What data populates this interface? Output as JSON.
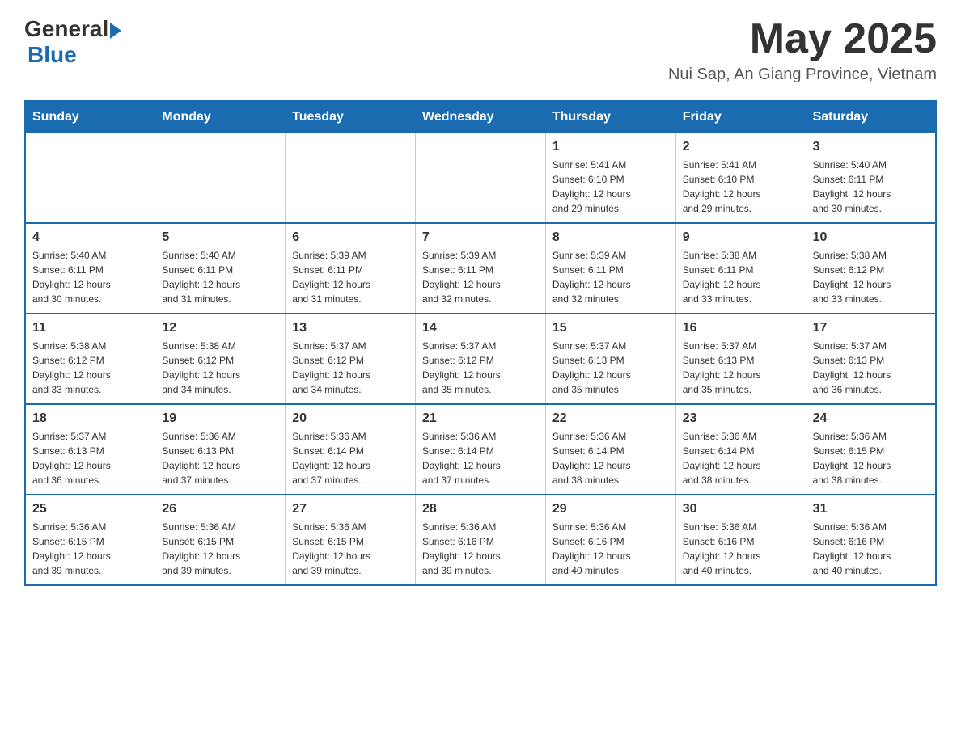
{
  "header": {
    "logo_general": "General",
    "logo_blue": "Blue",
    "month_title": "May 2025",
    "location": "Nui Sap, An Giang Province, Vietnam"
  },
  "weekdays": [
    "Sunday",
    "Monday",
    "Tuesday",
    "Wednesday",
    "Thursday",
    "Friday",
    "Saturday"
  ],
  "weeks": [
    [
      {
        "day": "",
        "info": ""
      },
      {
        "day": "",
        "info": ""
      },
      {
        "day": "",
        "info": ""
      },
      {
        "day": "",
        "info": ""
      },
      {
        "day": "1",
        "info": "Sunrise: 5:41 AM\nSunset: 6:10 PM\nDaylight: 12 hours\nand 29 minutes."
      },
      {
        "day": "2",
        "info": "Sunrise: 5:41 AM\nSunset: 6:10 PM\nDaylight: 12 hours\nand 29 minutes."
      },
      {
        "day": "3",
        "info": "Sunrise: 5:40 AM\nSunset: 6:11 PM\nDaylight: 12 hours\nand 30 minutes."
      }
    ],
    [
      {
        "day": "4",
        "info": "Sunrise: 5:40 AM\nSunset: 6:11 PM\nDaylight: 12 hours\nand 30 minutes."
      },
      {
        "day": "5",
        "info": "Sunrise: 5:40 AM\nSunset: 6:11 PM\nDaylight: 12 hours\nand 31 minutes."
      },
      {
        "day": "6",
        "info": "Sunrise: 5:39 AM\nSunset: 6:11 PM\nDaylight: 12 hours\nand 31 minutes."
      },
      {
        "day": "7",
        "info": "Sunrise: 5:39 AM\nSunset: 6:11 PM\nDaylight: 12 hours\nand 32 minutes."
      },
      {
        "day": "8",
        "info": "Sunrise: 5:39 AM\nSunset: 6:11 PM\nDaylight: 12 hours\nand 32 minutes."
      },
      {
        "day": "9",
        "info": "Sunrise: 5:38 AM\nSunset: 6:11 PM\nDaylight: 12 hours\nand 33 minutes."
      },
      {
        "day": "10",
        "info": "Sunrise: 5:38 AM\nSunset: 6:12 PM\nDaylight: 12 hours\nand 33 minutes."
      }
    ],
    [
      {
        "day": "11",
        "info": "Sunrise: 5:38 AM\nSunset: 6:12 PM\nDaylight: 12 hours\nand 33 minutes."
      },
      {
        "day": "12",
        "info": "Sunrise: 5:38 AM\nSunset: 6:12 PM\nDaylight: 12 hours\nand 34 minutes."
      },
      {
        "day": "13",
        "info": "Sunrise: 5:37 AM\nSunset: 6:12 PM\nDaylight: 12 hours\nand 34 minutes."
      },
      {
        "day": "14",
        "info": "Sunrise: 5:37 AM\nSunset: 6:12 PM\nDaylight: 12 hours\nand 35 minutes."
      },
      {
        "day": "15",
        "info": "Sunrise: 5:37 AM\nSunset: 6:13 PM\nDaylight: 12 hours\nand 35 minutes."
      },
      {
        "day": "16",
        "info": "Sunrise: 5:37 AM\nSunset: 6:13 PM\nDaylight: 12 hours\nand 35 minutes."
      },
      {
        "day": "17",
        "info": "Sunrise: 5:37 AM\nSunset: 6:13 PM\nDaylight: 12 hours\nand 36 minutes."
      }
    ],
    [
      {
        "day": "18",
        "info": "Sunrise: 5:37 AM\nSunset: 6:13 PM\nDaylight: 12 hours\nand 36 minutes."
      },
      {
        "day": "19",
        "info": "Sunrise: 5:36 AM\nSunset: 6:13 PM\nDaylight: 12 hours\nand 37 minutes."
      },
      {
        "day": "20",
        "info": "Sunrise: 5:36 AM\nSunset: 6:14 PM\nDaylight: 12 hours\nand 37 minutes."
      },
      {
        "day": "21",
        "info": "Sunrise: 5:36 AM\nSunset: 6:14 PM\nDaylight: 12 hours\nand 37 minutes."
      },
      {
        "day": "22",
        "info": "Sunrise: 5:36 AM\nSunset: 6:14 PM\nDaylight: 12 hours\nand 38 minutes."
      },
      {
        "day": "23",
        "info": "Sunrise: 5:36 AM\nSunset: 6:14 PM\nDaylight: 12 hours\nand 38 minutes."
      },
      {
        "day": "24",
        "info": "Sunrise: 5:36 AM\nSunset: 6:15 PM\nDaylight: 12 hours\nand 38 minutes."
      }
    ],
    [
      {
        "day": "25",
        "info": "Sunrise: 5:36 AM\nSunset: 6:15 PM\nDaylight: 12 hours\nand 39 minutes."
      },
      {
        "day": "26",
        "info": "Sunrise: 5:36 AM\nSunset: 6:15 PM\nDaylight: 12 hours\nand 39 minutes."
      },
      {
        "day": "27",
        "info": "Sunrise: 5:36 AM\nSunset: 6:15 PM\nDaylight: 12 hours\nand 39 minutes."
      },
      {
        "day": "28",
        "info": "Sunrise: 5:36 AM\nSunset: 6:16 PM\nDaylight: 12 hours\nand 39 minutes."
      },
      {
        "day": "29",
        "info": "Sunrise: 5:36 AM\nSunset: 6:16 PM\nDaylight: 12 hours\nand 40 minutes."
      },
      {
        "day": "30",
        "info": "Sunrise: 5:36 AM\nSunset: 6:16 PM\nDaylight: 12 hours\nand 40 minutes."
      },
      {
        "day": "31",
        "info": "Sunrise: 5:36 AM\nSunset: 6:16 PM\nDaylight: 12 hours\nand 40 minutes."
      }
    ]
  ]
}
